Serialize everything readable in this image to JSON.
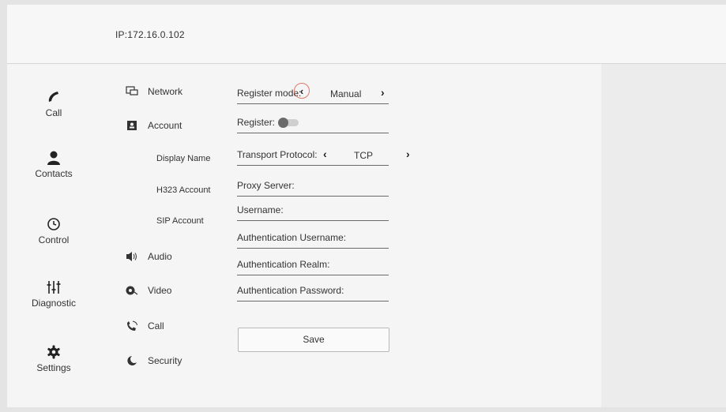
{
  "header": {
    "ip": "IP:172.16.0.102"
  },
  "left_nav": [
    {
      "label": "Call",
      "icon": "phone-icon"
    },
    {
      "label": "Contacts",
      "icon": "person-icon"
    },
    {
      "label": "Control",
      "icon": "clock-icon"
    },
    {
      "label": "Diagnostic",
      "icon": "sliders-icon"
    },
    {
      "label": "Settings",
      "icon": "gear-icon"
    }
  ],
  "settings_menu": {
    "network": "Network",
    "account": "Account",
    "display_name": "Display Name",
    "h323_account": "H323 Account",
    "sip_account": "SIP Account",
    "audio": "Audio",
    "video": "Video",
    "call": "Call",
    "security": "Security"
  },
  "form": {
    "register_mode_label": "Register mode:",
    "register_mode_value": "Manual",
    "register_label": "Register:",
    "register_enabled": false,
    "transport_label": "Transport Protocol:",
    "transport_value": "TCP",
    "proxy_label": "Proxy Server:",
    "username_label": "Username:",
    "auth_username_label": "Authentication Username:",
    "auth_realm_label": "Authentication Realm:",
    "auth_password_label": "Authentication Password:",
    "save_label": "Save"
  },
  "glyphs": {
    "prev": "‹",
    "next": "›"
  },
  "colors": {
    "highlight_ring": "#e07a6a",
    "background": "#f5f5f5"
  }
}
